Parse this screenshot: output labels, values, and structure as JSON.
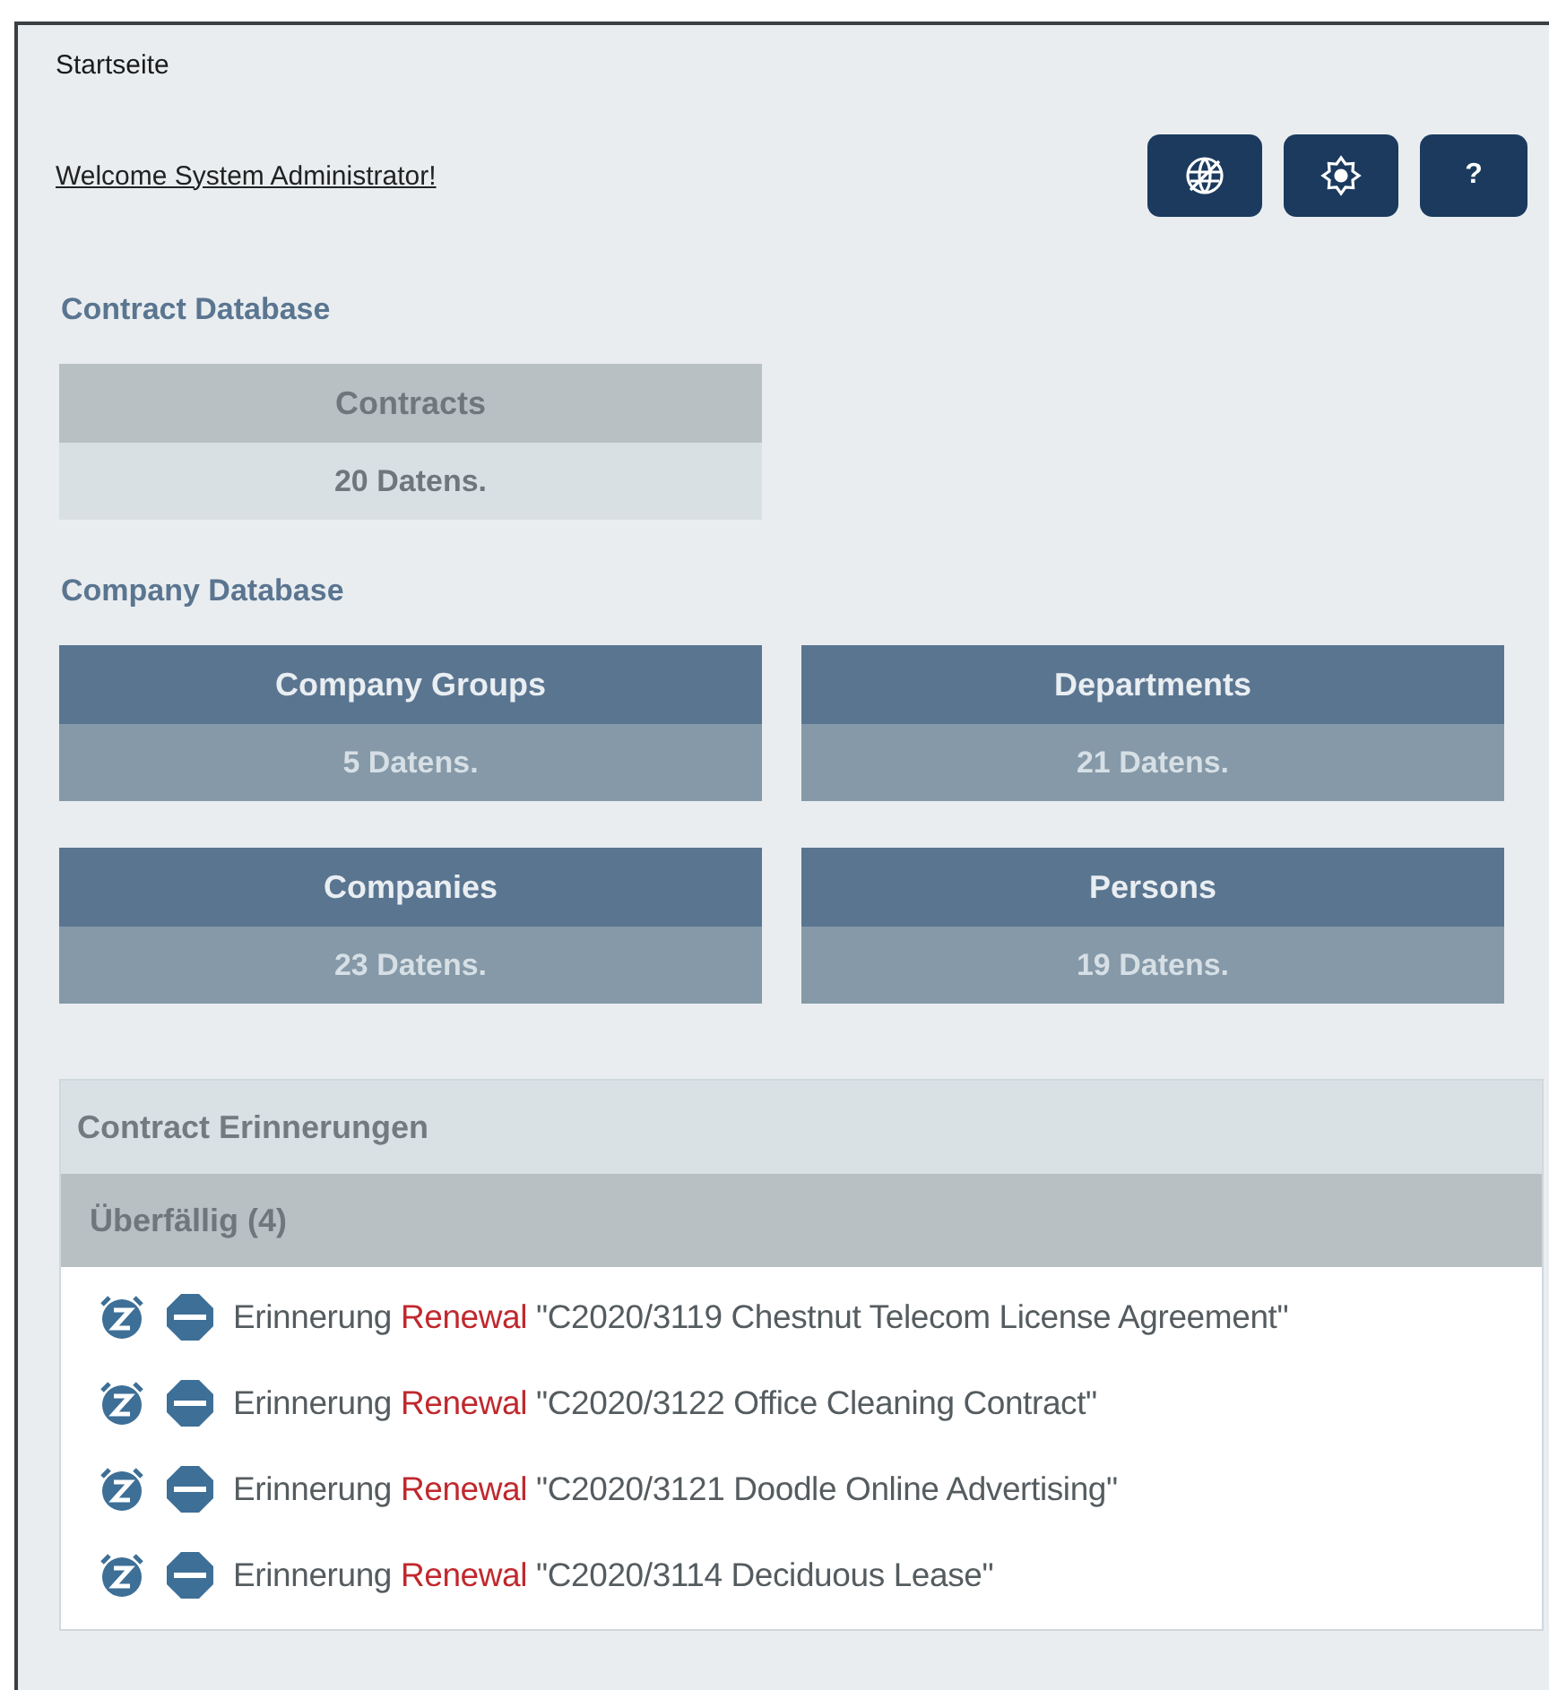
{
  "page": {
    "title": "Startseite"
  },
  "welcome_link": "Welcome System Administrator!",
  "toolbar_buttons": [
    {
      "kind": "globe"
    },
    {
      "kind": "settings"
    },
    {
      "kind": "help",
      "label": "?"
    }
  ],
  "sections": [
    {
      "title": "Contract Database",
      "tiles": [
        {
          "kind": "light",
          "name": "Contracts",
          "count": "20 Datens."
        }
      ]
    },
    {
      "title": "Company Database",
      "tiles": [
        {
          "kind": "dark",
          "name": "Company Groups",
          "count": "5 Datens."
        },
        {
          "kind": "dark",
          "name": "Departments",
          "count": "21 Datens."
        },
        {
          "kind": "dark",
          "name": "Companies",
          "count": "23 Datens."
        },
        {
          "kind": "dark",
          "name": "Persons",
          "count": "19 Datens."
        }
      ]
    }
  ],
  "reminders": {
    "title": "Contract Erinnerungen",
    "group": "Überfällig (4)",
    "items": [
      {
        "label": "Erinnerung",
        "type": "Renewal",
        "subject": "\"C2020/3119 Chestnut Telecom License Agreement\""
      },
      {
        "label": "Erinnerung",
        "type": "Renewal",
        "subject": "\"C2020/3122 Office Cleaning Contract\""
      },
      {
        "label": "Erinnerung",
        "type": "Renewal",
        "subject": "\"C2020/3121 Doodle Online Advertising\""
      },
      {
        "label": "Erinnerung",
        "type": "Renewal",
        "subject": "\"C2020/3114 Deciduous Lease\""
      }
    ]
  }
}
